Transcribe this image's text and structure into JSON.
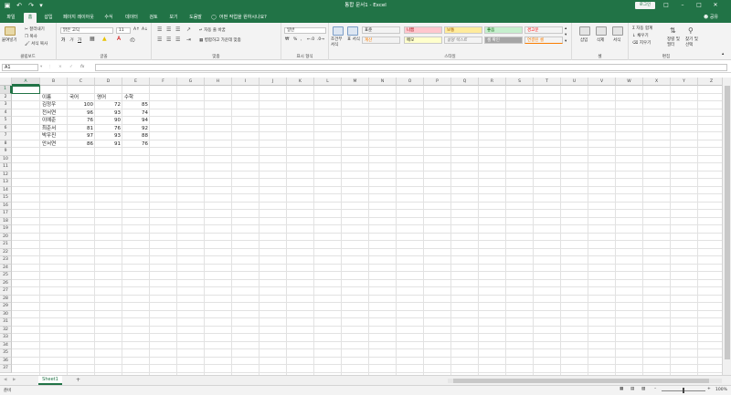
{
  "titlebar": {
    "title": "통합 문서1 - Excel",
    "login": "로그인",
    "save_icon": "save-icon",
    "undo_icon": "undo-icon",
    "redo_icon": "redo-icon"
  },
  "tabs": [
    "파일",
    "홈",
    "삽입",
    "페이지 레이아웃",
    "수식",
    "데이터",
    "검토",
    "보기",
    "도움말"
  ],
  "tell_me": "어떤 작업을 원하시나요?",
  "share": "공유",
  "ribbon": {
    "clipboard": {
      "paste": "붙여넣기",
      "cut": "잘라내기",
      "copy": "복사",
      "format_painter": "서식 복사",
      "label": "클립보드"
    },
    "font": {
      "name": "맑은 고딕",
      "size": "11",
      "label": "글꼴",
      "bold": "가",
      "italic": "가",
      "underline": "가"
    },
    "alignment": {
      "wrap": "자동 줄 바꿈",
      "merge": "병합하고 가운데 맞춤",
      "label": "맞춤"
    },
    "number": {
      "format": "일반",
      "percent": "%",
      "comma": ",",
      "label": "표시 형식"
    },
    "styles": {
      "conditional": "조건부 서식",
      "table": "표 서식",
      "cells": [
        {
          "text": "표준",
          "bg": "#ffffff",
          "fg": "#222222"
        },
        {
          "text": "나쁨",
          "bg": "#ffc7ce",
          "fg": "#9c0006"
        },
        {
          "text": "보통",
          "bg": "#ffeb9c",
          "fg": "#9c5700"
        },
        {
          "text": "좋음",
          "bg": "#c6efce",
          "fg": "#006100"
        },
        {
          "text": "경고문",
          "bg": "#ffffff",
          "fg": "#ff0000"
        },
        {
          "text": "계산",
          "bg": "#f2f2f2",
          "fg": "#fa7d00"
        },
        {
          "text": "메모",
          "bg": "#ffffcc",
          "fg": "#222222"
        },
        {
          "text": "설명 텍스트",
          "bg": "#ffffff",
          "fg": "#7f7f7f"
        },
        {
          "text": "셀 확인",
          "bg": "#a5a5a5",
          "fg": "#ffffff"
        },
        {
          "text": "연결된 셀",
          "bg": "#ffffff",
          "fg": "#fa7d00"
        }
      ],
      "label": "스타일"
    },
    "cells_group": {
      "insert": "삽입",
      "delete": "삭제",
      "format": "서식",
      "label": "셀"
    },
    "editing": {
      "autosum": "자동 합계",
      "fill": "채우기",
      "clear": "지우기",
      "sort": "정렬 및 필터",
      "find": "찾기 및 선택",
      "label": "편집"
    }
  },
  "formula_bar": {
    "name_box": "A1",
    "fx": "fx",
    "cancel": "×",
    "enter": "✓"
  },
  "columns": [
    "A",
    "B",
    "C",
    "D",
    "E",
    "F",
    "G",
    "H",
    "I",
    "J",
    "K",
    "L",
    "M",
    "N",
    "O",
    "P",
    "Q",
    "R",
    "S",
    "T",
    "U",
    "V",
    "W",
    "X",
    "Y",
    "Z"
  ],
  "table": {
    "headers": [
      "이름",
      "국어",
      "영어",
      "수학"
    ],
    "rows": [
      [
        "김정우",
        "100",
        "72",
        "85"
      ],
      [
        "전서연",
        "96",
        "93",
        "74"
      ],
      [
        "이예준",
        "76",
        "90",
        "94"
      ],
      [
        "최준서",
        "81",
        "76",
        "92"
      ],
      [
        "박우진",
        "97",
        "93",
        "88"
      ],
      [
        "안서연",
        "86",
        "91",
        "76"
      ]
    ]
  },
  "sheet": {
    "name": "Sheet1",
    "add": "+"
  },
  "status": {
    "ready": "준비",
    "zoom": "100%"
  }
}
